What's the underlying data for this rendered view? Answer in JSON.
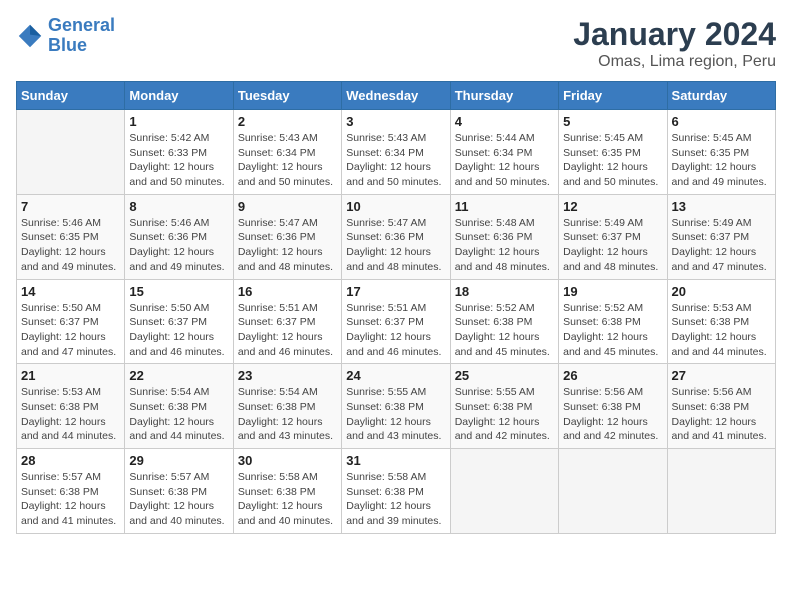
{
  "logo": {
    "line1": "General",
    "line2": "Blue"
  },
  "title": "January 2024",
  "subtitle": "Omas, Lima region, Peru",
  "columns": [
    "Sunday",
    "Monday",
    "Tuesday",
    "Wednesday",
    "Thursday",
    "Friday",
    "Saturday"
  ],
  "weeks": [
    [
      {
        "day": "",
        "sunrise": "",
        "sunset": "",
        "daylight": ""
      },
      {
        "day": "1",
        "sunrise": "Sunrise: 5:42 AM",
        "sunset": "Sunset: 6:33 PM",
        "daylight": "Daylight: 12 hours and 50 minutes."
      },
      {
        "day": "2",
        "sunrise": "Sunrise: 5:43 AM",
        "sunset": "Sunset: 6:34 PM",
        "daylight": "Daylight: 12 hours and 50 minutes."
      },
      {
        "day": "3",
        "sunrise": "Sunrise: 5:43 AM",
        "sunset": "Sunset: 6:34 PM",
        "daylight": "Daylight: 12 hours and 50 minutes."
      },
      {
        "day": "4",
        "sunrise": "Sunrise: 5:44 AM",
        "sunset": "Sunset: 6:34 PM",
        "daylight": "Daylight: 12 hours and 50 minutes."
      },
      {
        "day": "5",
        "sunrise": "Sunrise: 5:45 AM",
        "sunset": "Sunset: 6:35 PM",
        "daylight": "Daylight: 12 hours and 50 minutes."
      },
      {
        "day": "6",
        "sunrise": "Sunrise: 5:45 AM",
        "sunset": "Sunset: 6:35 PM",
        "daylight": "Daylight: 12 hours and 49 minutes."
      }
    ],
    [
      {
        "day": "7",
        "sunrise": "Sunrise: 5:46 AM",
        "sunset": "Sunset: 6:35 PM",
        "daylight": "Daylight: 12 hours and 49 minutes."
      },
      {
        "day": "8",
        "sunrise": "Sunrise: 5:46 AM",
        "sunset": "Sunset: 6:36 PM",
        "daylight": "Daylight: 12 hours and 49 minutes."
      },
      {
        "day": "9",
        "sunrise": "Sunrise: 5:47 AM",
        "sunset": "Sunset: 6:36 PM",
        "daylight": "Daylight: 12 hours and 48 minutes."
      },
      {
        "day": "10",
        "sunrise": "Sunrise: 5:47 AM",
        "sunset": "Sunset: 6:36 PM",
        "daylight": "Daylight: 12 hours and 48 minutes."
      },
      {
        "day": "11",
        "sunrise": "Sunrise: 5:48 AM",
        "sunset": "Sunset: 6:36 PM",
        "daylight": "Daylight: 12 hours and 48 minutes."
      },
      {
        "day": "12",
        "sunrise": "Sunrise: 5:49 AM",
        "sunset": "Sunset: 6:37 PM",
        "daylight": "Daylight: 12 hours and 48 minutes."
      },
      {
        "day": "13",
        "sunrise": "Sunrise: 5:49 AM",
        "sunset": "Sunset: 6:37 PM",
        "daylight": "Daylight: 12 hours and 47 minutes."
      }
    ],
    [
      {
        "day": "14",
        "sunrise": "Sunrise: 5:50 AM",
        "sunset": "Sunset: 6:37 PM",
        "daylight": "Daylight: 12 hours and 47 minutes."
      },
      {
        "day": "15",
        "sunrise": "Sunrise: 5:50 AM",
        "sunset": "Sunset: 6:37 PM",
        "daylight": "Daylight: 12 hours and 46 minutes."
      },
      {
        "day": "16",
        "sunrise": "Sunrise: 5:51 AM",
        "sunset": "Sunset: 6:37 PM",
        "daylight": "Daylight: 12 hours and 46 minutes."
      },
      {
        "day": "17",
        "sunrise": "Sunrise: 5:51 AM",
        "sunset": "Sunset: 6:37 PM",
        "daylight": "Daylight: 12 hours and 46 minutes."
      },
      {
        "day": "18",
        "sunrise": "Sunrise: 5:52 AM",
        "sunset": "Sunset: 6:38 PM",
        "daylight": "Daylight: 12 hours and 45 minutes."
      },
      {
        "day": "19",
        "sunrise": "Sunrise: 5:52 AM",
        "sunset": "Sunset: 6:38 PM",
        "daylight": "Daylight: 12 hours and 45 minutes."
      },
      {
        "day": "20",
        "sunrise": "Sunrise: 5:53 AM",
        "sunset": "Sunset: 6:38 PM",
        "daylight": "Daylight: 12 hours and 44 minutes."
      }
    ],
    [
      {
        "day": "21",
        "sunrise": "Sunrise: 5:53 AM",
        "sunset": "Sunset: 6:38 PM",
        "daylight": "Daylight: 12 hours and 44 minutes."
      },
      {
        "day": "22",
        "sunrise": "Sunrise: 5:54 AM",
        "sunset": "Sunset: 6:38 PM",
        "daylight": "Daylight: 12 hours and 44 minutes."
      },
      {
        "day": "23",
        "sunrise": "Sunrise: 5:54 AM",
        "sunset": "Sunset: 6:38 PM",
        "daylight": "Daylight: 12 hours and 43 minutes."
      },
      {
        "day": "24",
        "sunrise": "Sunrise: 5:55 AM",
        "sunset": "Sunset: 6:38 PM",
        "daylight": "Daylight: 12 hours and 43 minutes."
      },
      {
        "day": "25",
        "sunrise": "Sunrise: 5:55 AM",
        "sunset": "Sunset: 6:38 PM",
        "daylight": "Daylight: 12 hours and 42 minutes."
      },
      {
        "day": "26",
        "sunrise": "Sunrise: 5:56 AM",
        "sunset": "Sunset: 6:38 PM",
        "daylight": "Daylight: 12 hours and 42 minutes."
      },
      {
        "day": "27",
        "sunrise": "Sunrise: 5:56 AM",
        "sunset": "Sunset: 6:38 PM",
        "daylight": "Daylight: 12 hours and 41 minutes."
      }
    ],
    [
      {
        "day": "28",
        "sunrise": "Sunrise: 5:57 AM",
        "sunset": "Sunset: 6:38 PM",
        "daylight": "Daylight: 12 hours and 41 minutes."
      },
      {
        "day": "29",
        "sunrise": "Sunrise: 5:57 AM",
        "sunset": "Sunset: 6:38 PM",
        "daylight": "Daylight: 12 hours and 40 minutes."
      },
      {
        "day": "30",
        "sunrise": "Sunrise: 5:58 AM",
        "sunset": "Sunset: 6:38 PM",
        "daylight": "Daylight: 12 hours and 40 minutes."
      },
      {
        "day": "31",
        "sunrise": "Sunrise: 5:58 AM",
        "sunset": "Sunset: 6:38 PM",
        "daylight": "Daylight: 12 hours and 39 minutes."
      },
      {
        "day": "",
        "sunrise": "",
        "sunset": "",
        "daylight": ""
      },
      {
        "day": "",
        "sunrise": "",
        "sunset": "",
        "daylight": ""
      },
      {
        "day": "",
        "sunrise": "",
        "sunset": "",
        "daylight": ""
      }
    ]
  ]
}
